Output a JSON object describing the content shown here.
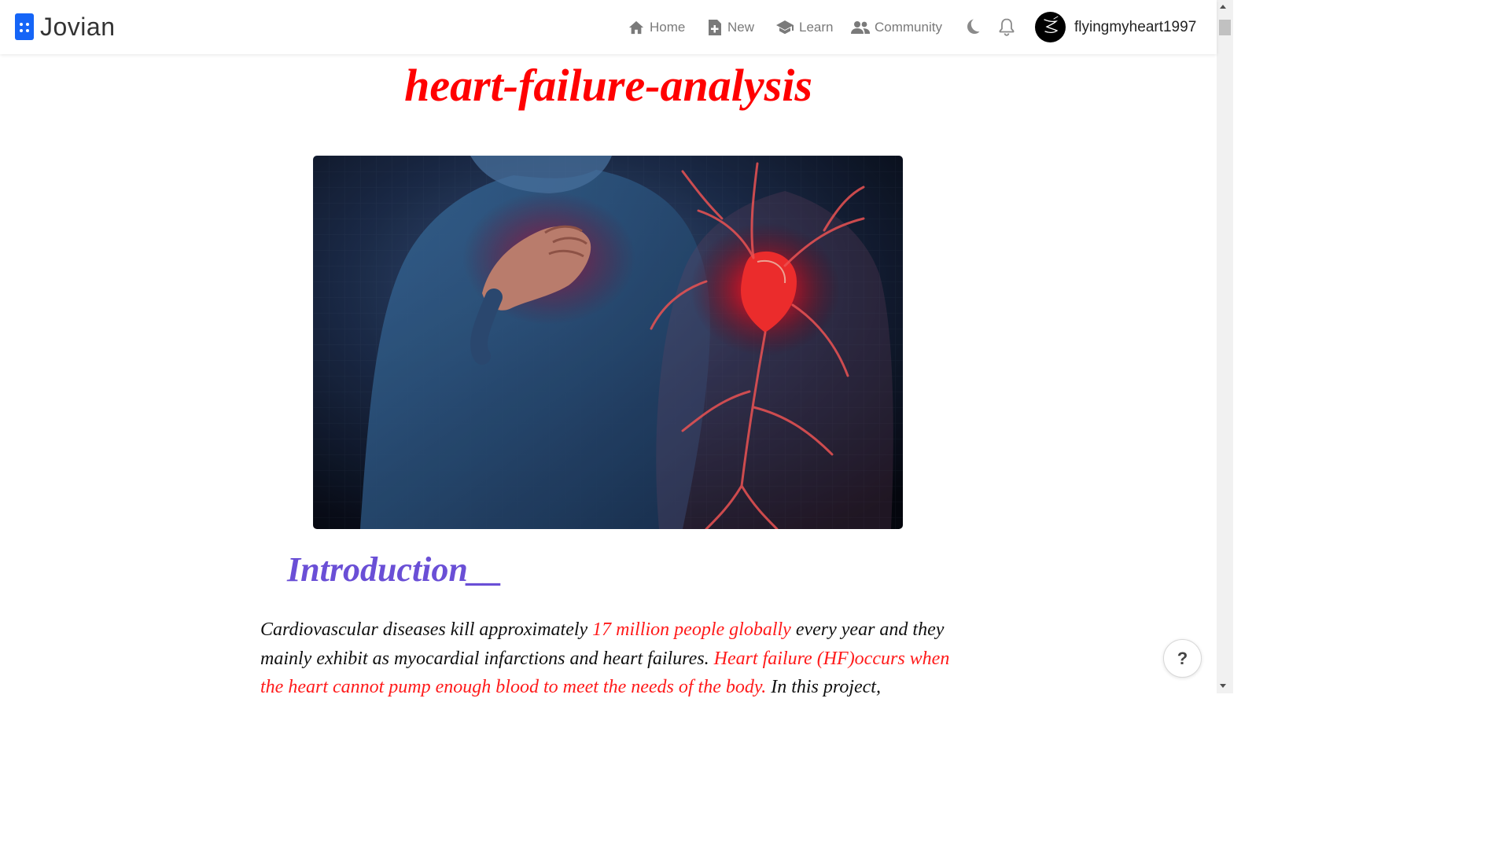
{
  "header": {
    "logo_text": "Jovian",
    "nav": {
      "home": "Home",
      "new": "New",
      "learn": "Learn",
      "community": "Community"
    },
    "icons": [
      "home-icon",
      "new-notebook-icon",
      "learn-icon",
      "community-icon",
      "dark-mode-icon",
      "bell-icon",
      "avatar"
    ],
    "username": "flyingmyheart1997"
  },
  "notebook": {
    "title": "heart-failure-analysis",
    "section_heading": "Introduction__",
    "intro": {
      "t1": "Cardiovascular diseases kill approximately ",
      "h1": "17 million people globally",
      "t2": " every year and they mainly exhibit as myocardial infarctions and heart failures. ",
      "h2": "Heart failure (HF)occurs when the heart cannot pump enough blood to meet the needs of the body.",
      "t3": " In this project,"
    }
  },
  "help": {
    "label": "?"
  },
  "colors": {
    "title": "#ff0000",
    "heading": "#6a4fd6",
    "highlight": "#ff1a1a",
    "brand": "#1565f7"
  }
}
